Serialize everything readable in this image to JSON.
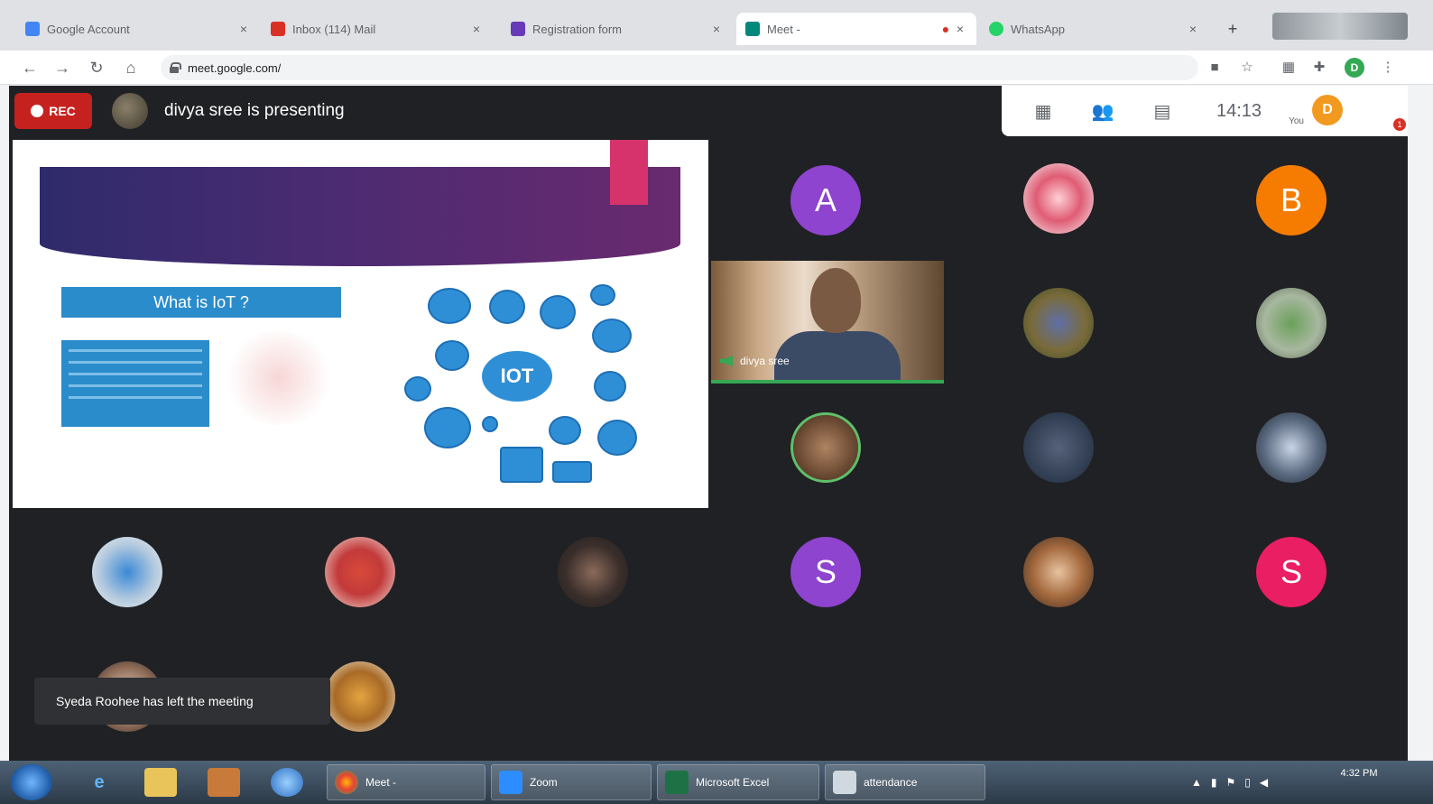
{
  "browser": {
    "tabs": [
      {
        "label": "Google Account",
        "favicon_color": "#4285f4",
        "active": false
      },
      {
        "label": "Inbox (114) Mail",
        "favicon_color": "#d93025",
        "active": false
      },
      {
        "label": "Registration form",
        "favicon_color": "#673ab7",
        "active": false
      },
      {
        "label": "Meet - ",
        "favicon_color": "#00897b",
        "active": true
      },
      {
        "label": "WhatsApp",
        "favicon_color": "#25d366",
        "active": false
      }
    ],
    "url": "meet.google.com/"
  },
  "meet": {
    "rec_label": "REC",
    "presenting_text": "divya sree is presenting",
    "clock": "14:13",
    "you_initial": "D",
    "you_label": "You",
    "notification_count": "1",
    "video_name": "divya sree",
    "toast": "Syeda Roohee has left the meeting",
    "letter_avatars": [
      {
        "letter": "A",
        "color": "#8e44ce"
      },
      {
        "letter": "B",
        "color": "#f57c00"
      },
      {
        "letter": "S",
        "color": "#8e44ce"
      },
      {
        "letter": "S",
        "color": "#e91e63"
      }
    ]
  },
  "slide": {
    "heading": "What is IoT ?",
    "hub_label": "IOT"
  },
  "taskbar": {
    "tasks": [
      {
        "label": "Meet - ",
        "icon_color": "#e0e0e0"
      },
      {
        "label": "Zoom",
        "icon_color": "#2d8cff"
      },
      {
        "label": "Microsoft Excel",
        "icon_color": "#1e7145"
      },
      {
        "label": "attendance",
        "icon_color": "#d0d8e0"
      }
    ],
    "clock_time": "4:32 PM"
  },
  "accent_colors": {
    "rec": "#c5221f",
    "speaking": "#34a853"
  }
}
